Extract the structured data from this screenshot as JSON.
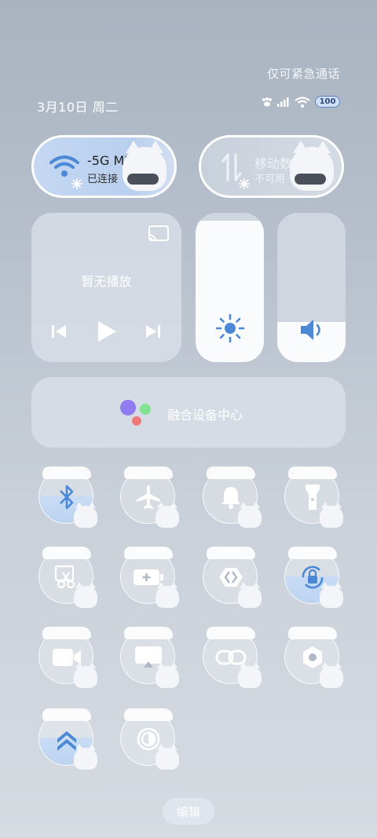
{
  "status": {
    "emergency_text": "仅可紧急通话",
    "date_text": "3月10日 周二",
    "battery": "100"
  },
  "wifi_tile": {
    "title": "-5G   MIC",
    "subtitle": "已连接",
    "active": true
  },
  "mobile_tile": {
    "title": "移动数",
    "subtitle": "不可用",
    "active": false
  },
  "media": {
    "no_play_text": "暂无播放"
  },
  "sliders": {
    "brightness_level": 0.95,
    "volume_level": 0.27
  },
  "fusion": {
    "label": "融合设备中心",
    "colors": [
      "#8f7cf0",
      "#7fe38f",
      "#f07a7a"
    ]
  },
  "toggles": [
    {
      "name": "bluetooth",
      "icon": "bluetooth-icon",
      "active": true
    },
    {
      "name": "airplane",
      "icon": "airplane-icon",
      "active": false
    },
    {
      "name": "sound",
      "icon": "bell-icon",
      "active": false
    },
    {
      "name": "flashlight",
      "icon": "flashlight-icon",
      "active": false
    },
    {
      "name": "screenshot",
      "icon": "scissors-icon",
      "active": false
    },
    {
      "name": "battery-saver",
      "icon": "battery-plus-icon",
      "active": false
    },
    {
      "name": "nearby-share",
      "icon": "share-icon",
      "active": false
    },
    {
      "name": "rotation-lock",
      "icon": "rotation-lock-icon",
      "active": true
    },
    {
      "name": "screen-record",
      "icon": "video-camera-icon",
      "active": false
    },
    {
      "name": "screen-cast",
      "icon": "cast-screen-icon",
      "active": false
    },
    {
      "name": "link",
      "icon": "link-icon",
      "active": false
    },
    {
      "name": "settings-nut",
      "icon": "hex-nut-icon",
      "active": false
    },
    {
      "name": "performance",
      "icon": "chevrons-up-icon",
      "active": true
    },
    {
      "name": "dark-mode",
      "icon": "contrast-icon",
      "active": false
    }
  ],
  "edit": {
    "label": "编辑"
  }
}
